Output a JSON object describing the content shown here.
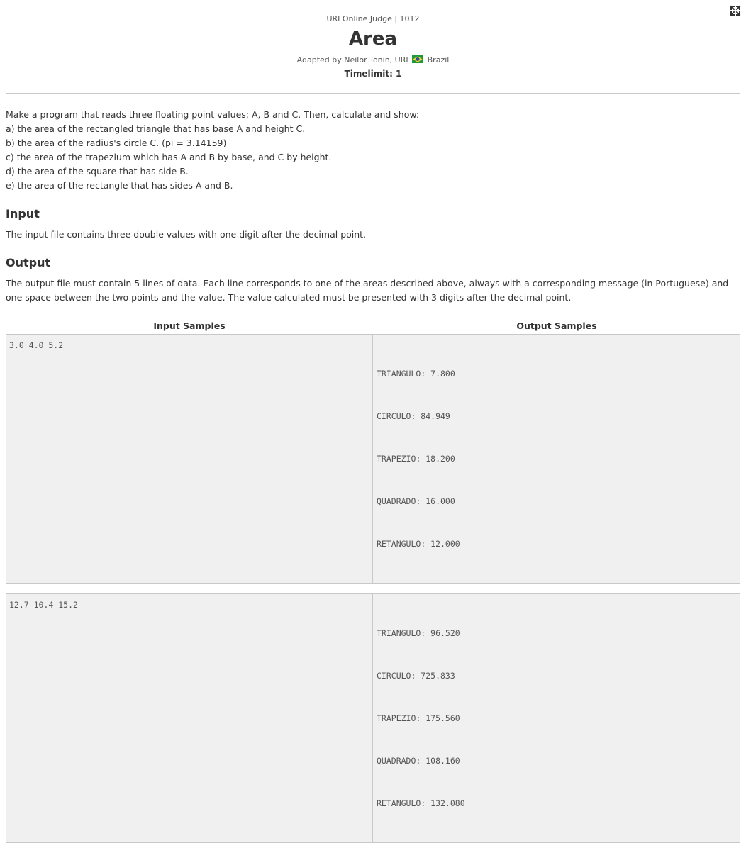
{
  "header": {
    "judge_line": "URI Online Judge | 1012",
    "title": "Area",
    "author_prefix": "Adapted by Neilor Tonin, URI",
    "country": "Brazil",
    "timelimit": "Timelimit: 1"
  },
  "icons": {
    "fullscreen": "expand-arrows-icon",
    "flag": "brazil-flag-icon"
  },
  "colors": {
    "flag_green": "#1e9a3c",
    "flag_yellow": "#f6d32a",
    "flag_blue": "#2a4ea0",
    "sample_bg": "#f0f0f0",
    "border": "#c8c8c8"
  },
  "description": [
    "Make a program that reads three floating point values: A, B and C. Then, calculate and show:",
    "a) the area of the rectangled triangle that has base A and height C.",
    "b) the area of the radius's circle C. (pi = 3.14159)",
    "c) the area of the trapezium which has A and B by base, and C by height.",
    "d) the area of the square that has side B.",
    "e) the area of the rectangle that has sides A and B."
  ],
  "input_section": {
    "title": "Input",
    "text": "The input file contains three double values with one digit after the decimal point."
  },
  "output_section": {
    "title": "Output",
    "text": "The output file must contain 5 lines of data. Each line corresponds to one of the areas described above, always with a corresponding message (in Portuguese) and one space between the two points and the value. The value calculated must be presented with 3 digits after the decimal point."
  },
  "samples": {
    "input_header": "Input Samples",
    "output_header": "Output Samples",
    "cases": [
      {
        "input": "3.0 4.0 5.2",
        "output": [
          "TRIANGULO: 7.800",
          "CIRCULO: 84.949",
          "TRAPEZIO: 18.200",
          "QUADRADO: 16.000",
          "RETANGULO: 12.000"
        ]
      },
      {
        "input": "12.7 10.4 15.2",
        "output": [
          "TRIANGULO: 96.520",
          "CIRCULO: 725.833",
          "TRAPEZIO: 175.560",
          "QUADRADO: 108.160",
          "RETANGULO: 132.080"
        ]
      }
    ]
  }
}
